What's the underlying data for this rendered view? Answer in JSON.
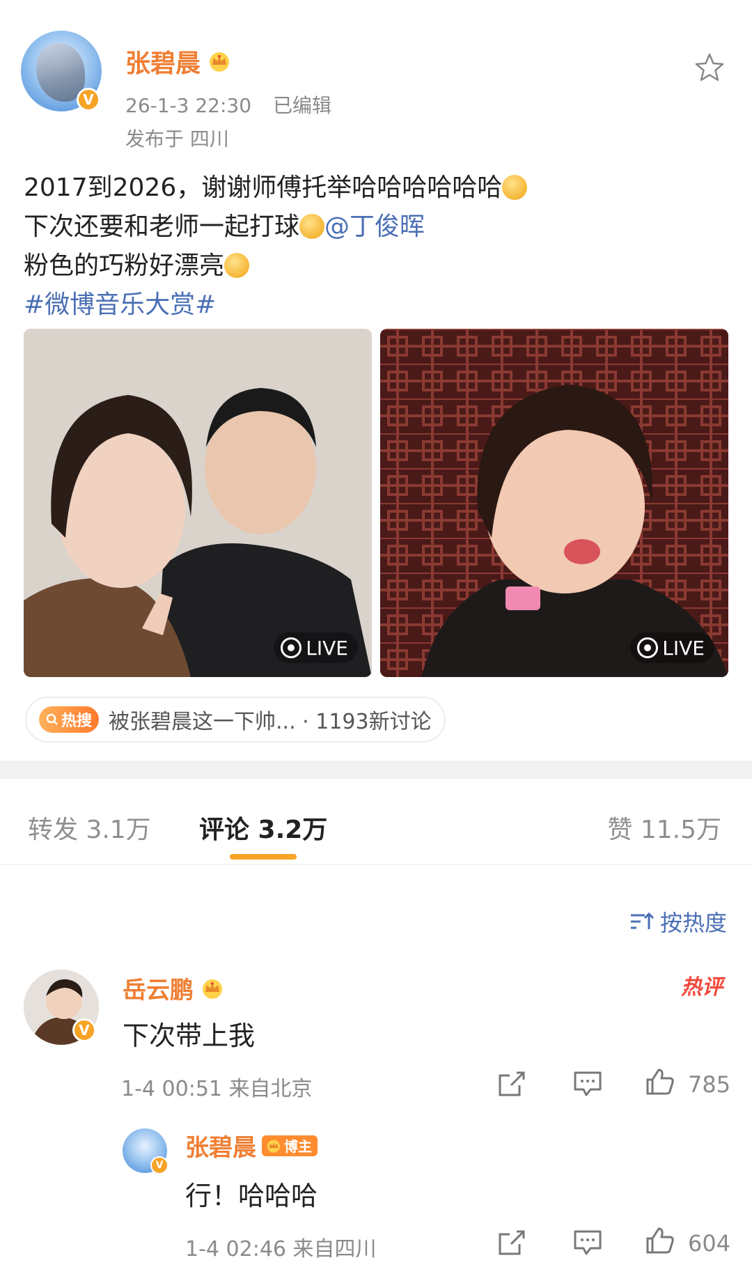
{
  "post": {
    "author": "张碧晨",
    "timestamp": "26-1-3 22:30",
    "edited": "已编辑",
    "location": "发布于 四川",
    "lines": {
      "line1": "2017到2026，谢谢师傅托举哈哈哈哈哈哈",
      "line2": "下次还要和老师一起打球",
      "mention": "@丁俊晖",
      "line3": "粉色的巧粉好漂亮",
      "topic": "#微博音乐大赏#"
    },
    "photos": [
      {
        "live_label": "LIVE"
      },
      {
        "live_label": "LIVE"
      }
    ],
    "hot_search": {
      "tag": "热搜",
      "text": "被张碧晨这一下帅... · 1193新讨论"
    }
  },
  "tabs": {
    "repost": "转发 3.1万",
    "comments": "评论 3.2万",
    "likes": "赞 11.5万"
  },
  "sort": {
    "label": "按热度"
  },
  "comments": [
    {
      "name": "岳云鹏",
      "text": "下次带上我",
      "meta": "1-4 00:51  来自北京",
      "like_count": "785",
      "badge": "热评"
    }
  ],
  "reply": {
    "name": "张碧晨",
    "role_tag": "博主",
    "text": "行！哈哈哈",
    "meta": "1-4 02:46  来自四川",
    "like_count": "604"
  },
  "icons": {
    "star": "star-outline-icon",
    "share": "share-icon",
    "comment": "comment-icon",
    "like": "thumbs-up-icon",
    "verified": "verified-v-icon",
    "crown": "crown-icon",
    "sort": "sort-icon"
  },
  "colors": {
    "username": "#ef7f34",
    "link": "#4a6fb5",
    "accent": "#f7a325",
    "hot_badge": "#f2493c"
  }
}
